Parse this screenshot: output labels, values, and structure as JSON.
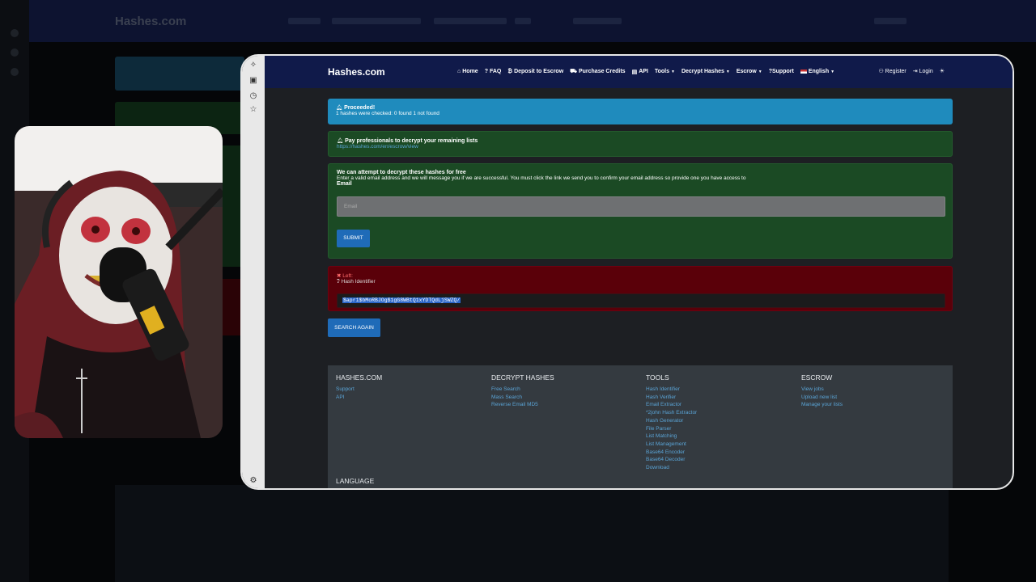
{
  "site": {
    "brand": "Hashes.com"
  },
  "nav": {
    "items": [
      {
        "icon": "home-icon",
        "glyph": "⌂",
        "label": "Home"
      },
      {
        "icon": "question-icon",
        "glyph": "?",
        "label": "FAQ"
      },
      {
        "icon": "bitcoin-icon",
        "glyph": "₿",
        "label": "Deposit to Escrow"
      },
      {
        "icon": "cart-icon",
        "glyph": "⛟",
        "label": "Purchase Credits"
      },
      {
        "icon": "code-icon",
        "glyph": "▤",
        "label": "API"
      }
    ],
    "dropdowns": [
      {
        "label": "Tools"
      },
      {
        "label": "Decrypt Hashes"
      },
      {
        "label": "Escrow"
      }
    ],
    "support": "?Support",
    "language": "English",
    "register": "Register",
    "login": "Login"
  },
  "alerts": {
    "proceeded_title": "Proceeded!",
    "proceeded_text": "1 hashes were checked: 0 found 1 not found",
    "pay_title": "Pay professionals to decrypt your remaining lists",
    "pay_link": "https://hashes.com/en/escrow/view",
    "free_title": "We can attempt to decrypt these hashes for free",
    "free_text": "Enter a valid email address and we will message you if we are successful. You must click the link we send you to confirm your email address so provide one you have access to",
    "email_label": "Email",
    "email_placeholder": "Email",
    "submit": "SUBMIT",
    "left_label": "Left:",
    "hash_identifier": "Hash Identifier",
    "hash_value": "$apr1$bMoRBJOg$1gG8WBtQ1xYDTQdLjSWZQ/",
    "search_again": "SEARCH AGAIN"
  },
  "footer": {
    "columns": [
      {
        "title": "HASHES.COM",
        "items": [
          "Support",
          "API"
        ]
      },
      {
        "title": "DECRYPT HASHES",
        "items": [
          "Free Search",
          "Mass Search",
          "Reverse Email MD5"
        ]
      },
      {
        "title": "TOOLS",
        "items": [
          "Hash Identifier",
          "Hash Verifier",
          "Email Extractor",
          "*2john Hash Extractor",
          "Hash Generator",
          "File Parser",
          "List Matching",
          "List Management",
          "Base64 Encoder",
          "Base64 Decoder",
          "Download"
        ]
      },
      {
        "title": "ESCROW",
        "items": [
          "View jobs",
          "Upload new list",
          "Manage your lists"
        ]
      }
    ],
    "language_title": "LANGUAGE"
  },
  "colors": {
    "navbar": "#101a4a",
    "info": "#1f8bbd",
    "success_bg": "#1b4a24",
    "danger_bg": "#5a0009",
    "button": "#1f6bb8",
    "link": "#5aa4d6"
  }
}
